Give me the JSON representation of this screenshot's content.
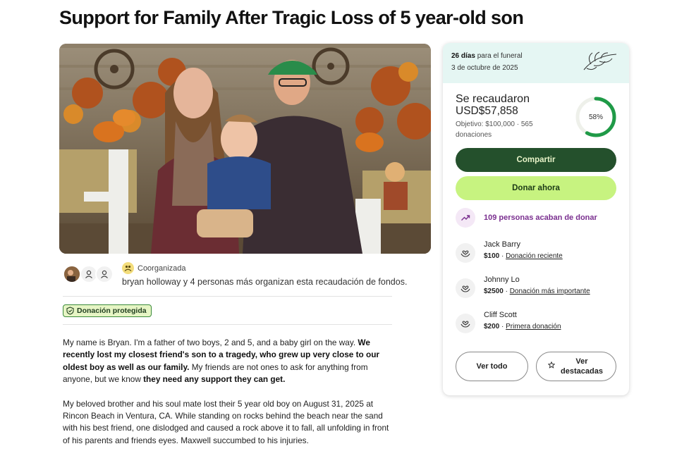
{
  "page": {
    "title": "Support for Family After Tragic Loss of 5 year-old son"
  },
  "organizer": {
    "badge": "Coorganizada",
    "text": "bryan holloway y 4 personas más organizan esta recaudación de fondos."
  },
  "protected_badge": "Donación protegida",
  "story": {
    "p1_a": "My name is Bryan. I'm a father of two boys, 2 and 5, and a baby girl on the way. ",
    "p1_b": "We recently lost my closest friend's son to a tragedy, who grew up very close to our oldest boy as well as our family.",
    "p1_c": " My friends are not ones to ask for anything from anyone, but we know ",
    "p1_d": "they need any support they can get.",
    "p2": "My beloved brother and his soul mate lost their 5 year old boy on August 31, 2025 at Rincon Beach in Ventura, CA. While standing on rocks behind the beach near the sand with his best friend, one dislodged and caused a rock above it to fall, all unfolding in front of his parents and friends eyes. Maxwell succumbed to his injuries."
  },
  "sidebar": {
    "countdown_bold": "26 días",
    "countdown_rest": " para el funeral",
    "funeral_date": "3 de octubre de 2025",
    "raised_label": "Se recaudaron",
    "raised_amount": "USD$57,858",
    "goal_text": "Objetivo: $100,000 · 565 donaciones",
    "progress_label": "58%",
    "progress_fraction": 0.58,
    "share_label": "Compartir",
    "donate_label": "Donar ahora",
    "recent_text": "109 personas acaban de donar",
    "donors": [
      {
        "name": "Jack Barry",
        "amount": "$100",
        "tag": "Donación reciente"
      },
      {
        "name": "Johnny Lo",
        "amount": "$2500",
        "tag": "Donación más importante"
      },
      {
        "name": "Cliff Scott",
        "amount": "$200",
        "tag": "Primera donación"
      }
    ],
    "see_all_label": "Ver todo",
    "see_featured_label": "Ver destacadas"
  },
  "colors": {
    "share_bg": "#24502c",
    "donate_bg": "#c7f380",
    "progress": "#1f9a47",
    "recent_accent": "#7a2f8f",
    "card_top_bg": "#e5f6f3"
  },
  "icons": [
    "organizer-avatar-photo",
    "person-icon",
    "hands-icon",
    "shield-check-icon",
    "palm-leaf-icon",
    "trending-up-icon",
    "heart-hands-icon",
    "star-icon"
  ]
}
